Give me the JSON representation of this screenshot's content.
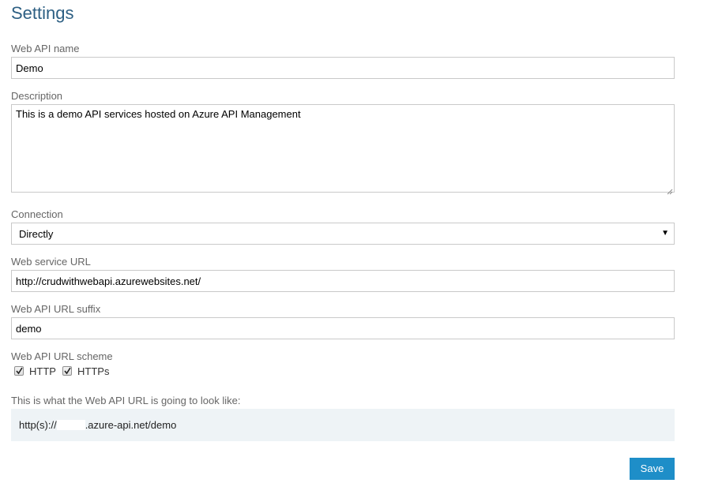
{
  "page": {
    "title": "Settings"
  },
  "form": {
    "name": {
      "label": "Web API name",
      "value": "Demo"
    },
    "description": {
      "label": "Description",
      "value": "This is a demo API services hosted on Azure API Management"
    },
    "connection": {
      "label": "Connection",
      "selected": "Directly"
    },
    "service_url": {
      "label": "Web service URL",
      "value": "http://crudwithwebapi.azurewebsites.net/"
    },
    "url_suffix": {
      "label": "Web API URL suffix",
      "value": "demo"
    },
    "url_scheme": {
      "label": "Web API URL scheme",
      "options": [
        {
          "label": "HTTP",
          "checked": true
        },
        {
          "label": "HTTPs",
          "checked": true
        }
      ]
    },
    "preview": {
      "label": "This is what the Web API URL is going to look like:",
      "url_prefix": "http(s)://",
      "url_suffix_text": ".azure-api.net/demo"
    }
  },
  "actions": {
    "save_label": "Save"
  },
  "colors": {
    "title": "#2d5f83",
    "save_button": "#1e8ec8",
    "preview_background": "#eef3f6"
  }
}
